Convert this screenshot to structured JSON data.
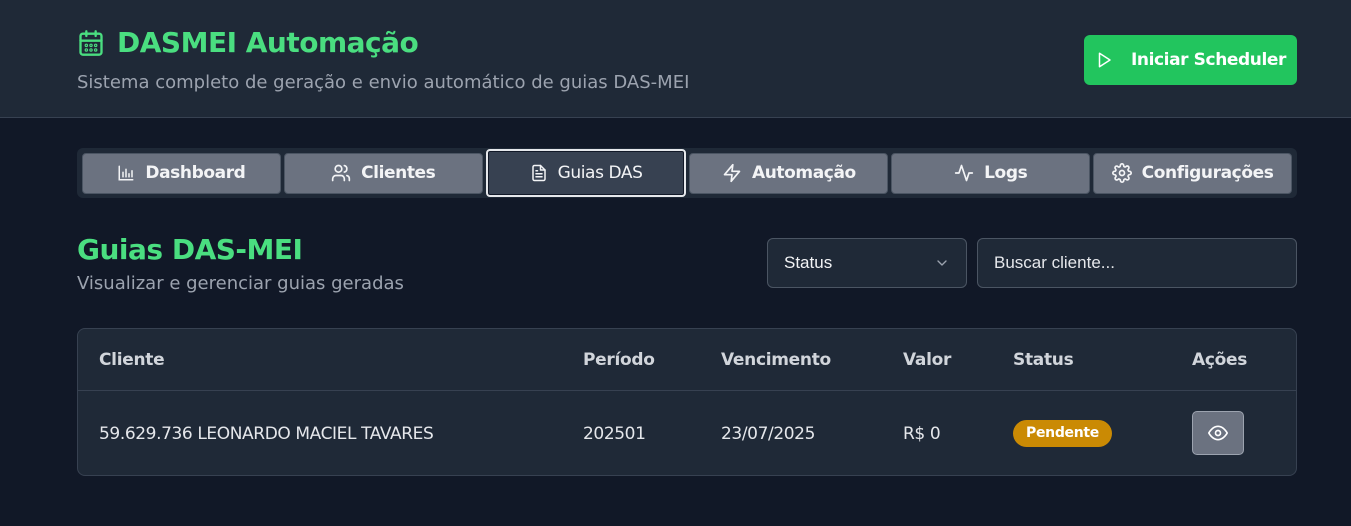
{
  "header": {
    "title": "DASMEI Automação",
    "subtitle": "Sistema completo de geração e envio automático de guias DAS-MEI",
    "scheduler_button": "Iniciar Scheduler"
  },
  "tabs": [
    {
      "label": "Dashboard",
      "icon": "bar-chart-icon"
    },
    {
      "label": "Clientes",
      "icon": "users-icon"
    },
    {
      "label": "Guias DAS",
      "icon": "document-icon",
      "active": true
    },
    {
      "label": "Automação",
      "icon": "lightning-icon"
    },
    {
      "label": "Logs",
      "icon": "activity-icon"
    },
    {
      "label": "Configurações",
      "icon": "gear-icon"
    }
  ],
  "section": {
    "title": "Guias DAS-MEI",
    "subtitle": "Visualizar e gerenciar guias geradas"
  },
  "filters": {
    "status_label": "Status",
    "search_placeholder": "Buscar cliente..."
  },
  "table": {
    "columns": [
      "Cliente",
      "Período",
      "Vencimento",
      "Valor",
      "Status",
      "Ações"
    ],
    "rows": [
      {
        "cliente": "59.629.736 LEONARDO MACIEL TAVARES",
        "periodo": "202501",
        "vencimento": "23/07/2025",
        "valor": "R$ 0",
        "status": "Pendente"
      }
    ]
  },
  "colors": {
    "accent_green": "#4ade80",
    "button_green": "#22c55e",
    "pending_badge": "#ca8a04",
    "background": "#111827",
    "panel": "#1f2937"
  }
}
